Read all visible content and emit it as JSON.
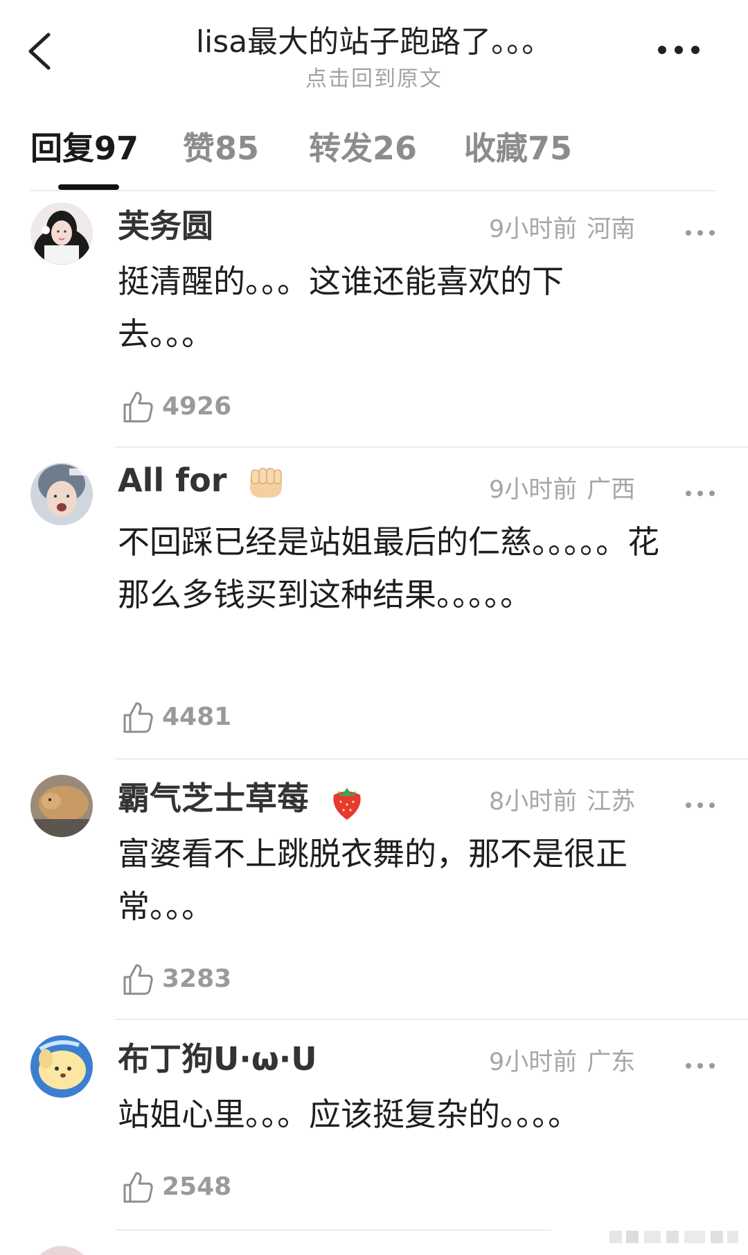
{
  "header": {
    "title": "lisa最大的站子跑路了。。。",
    "subtitle": "点击回到原文",
    "back_icon": "chevron-left-icon",
    "more_icon": "more-horizontal-icon"
  },
  "tabs": [
    {
      "label": "回复",
      "count": "97",
      "active": true
    },
    {
      "label": "赞",
      "count": "85",
      "active": false
    },
    {
      "label": "转发",
      "count": "26",
      "active": false
    },
    {
      "label": "收藏",
      "count": "75",
      "active": false
    }
  ],
  "comments": [
    {
      "username": "芙务圆",
      "time": "9小时前",
      "location": "河南",
      "text": "挺清醒的。。。这谁还能喜欢的下去。。。",
      "likes": "4926"
    },
    {
      "username": "All for",
      "username_emoji": "fist-emoji",
      "time": "9小时前",
      "location": "广西",
      "text": "不回踩已经是站姐最后的仁慈。。。。。花那么多钱买到这种结果。。。。。",
      "likes": "4481"
    },
    {
      "username": "霸气芝士草莓",
      "username_emoji": "strawberry-emoji",
      "time": "8小时前",
      "location": "江苏",
      "text": "富婆看不上跳脱衣舞的，那不是很正常。。。",
      "likes": "3283"
    },
    {
      "username": "布丁狗U·ω·U",
      "time": "9小时前",
      "location": "广东",
      "text": "站姐心里。。。应该挺复杂的。。。。",
      "likes": "2548"
    }
  ],
  "colors": {
    "primary_text": "#1a1a1a",
    "secondary_text": "#a6a6a6",
    "divider": "#ececec",
    "strawberry": "#e8382f"
  }
}
